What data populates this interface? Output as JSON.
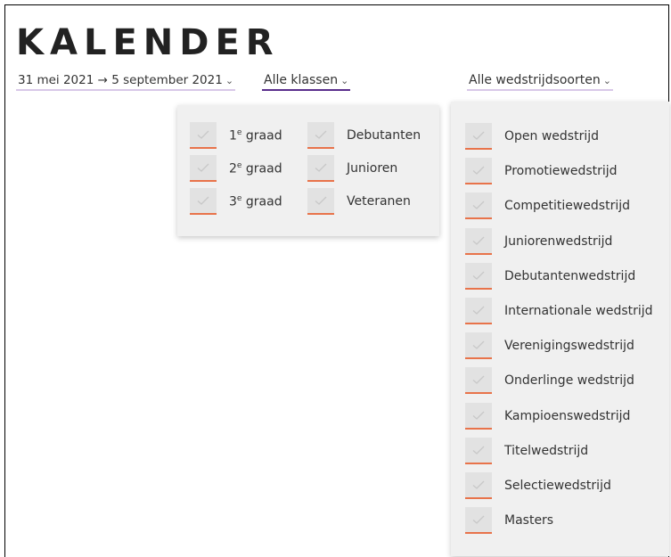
{
  "page": {
    "title": "KALENDER"
  },
  "filters": {
    "date_range": "31 mei 2021 → 5 september 2021",
    "classes_label": "Alle klassen",
    "types_label": "Alle wedstrijdsoorten",
    "chevron": "⌄"
  },
  "class_options": {
    "col1": [
      "1e graad",
      "2e graad",
      "3e graad"
    ],
    "col2": [
      "Debutanten",
      "Junioren",
      "Veteranen"
    ]
  },
  "type_options": [
    "Open wedstrijd",
    "Promotiewedstrijd",
    "Competitiewedstrijd",
    "Juniorenwedstrijd",
    "Debutantenwedstrijd",
    "Internationale wedstrijd",
    "Verenigingswedstrijd",
    "Onderlinge wedstrijd",
    "Kampioenswedstrijd",
    "Titelwedstrijd",
    "Selectiewedstrijd",
    "Masters"
  ],
  "colors": {
    "accent": "#5a2e8c",
    "check_underline": "#e8734a",
    "dropdown_bg": "#f0f0f0"
  }
}
